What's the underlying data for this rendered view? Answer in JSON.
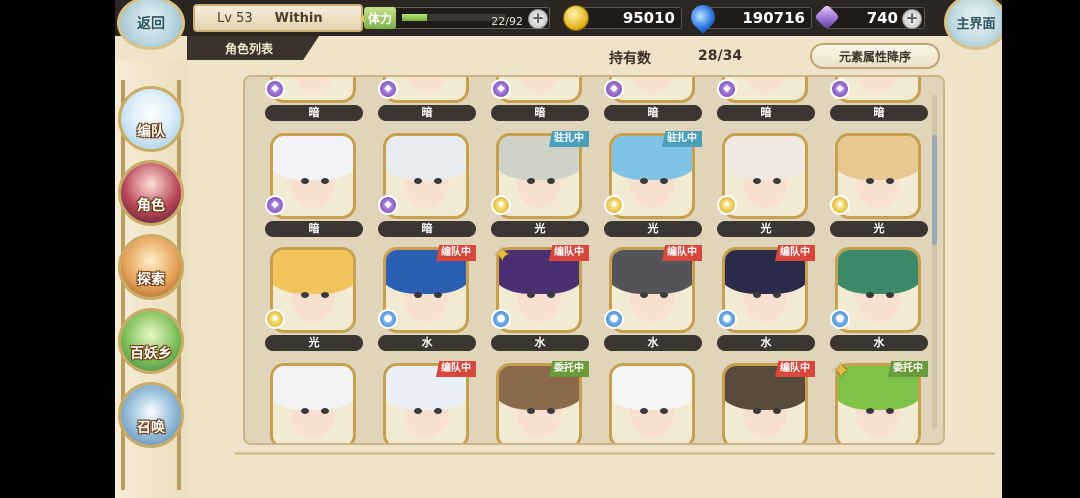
{
  "back_label": "返回",
  "home_label": "主界面",
  "player": {
    "level": "Lv 53",
    "name": "Within"
  },
  "stamina": {
    "label": "体力",
    "current": 22,
    "max": 92,
    "text": "22/92"
  },
  "currencies": {
    "gold": "95010",
    "crystal": "190716",
    "gem": "740"
  },
  "tab_title": "角色列表",
  "owned": {
    "label": "持有数",
    "count": "28/34"
  },
  "sort_label": "元素属性降序",
  "nav": [
    {
      "label": "编队"
    },
    {
      "label": "角色"
    },
    {
      "label": "探索"
    },
    {
      "label": "百妖乡"
    },
    {
      "label": "召唤"
    }
  ],
  "elements": {
    "dark": "暗",
    "light": "光",
    "water": "水"
  },
  "rows": [
    [
      {
        "element": "暗",
        "tag": ""
      },
      {
        "element": "暗",
        "tag": ""
      },
      {
        "element": "暗",
        "tag": ""
      },
      {
        "element": "暗",
        "tag": ""
      },
      {
        "element": "暗",
        "tag": ""
      },
      {
        "element": "暗",
        "tag": ""
      }
    ],
    [
      {
        "element": "暗",
        "tag": ""
      },
      {
        "element": "暗",
        "tag": ""
      },
      {
        "element": "光",
        "tag": "驻扎中"
      },
      {
        "element": "光",
        "tag": "驻扎中"
      },
      {
        "element": "光",
        "tag": ""
      },
      {
        "element": "光",
        "tag": ""
      }
    ],
    [
      {
        "element": "光",
        "tag": ""
      },
      {
        "element": "水",
        "tag": "编队中"
      },
      {
        "element": "水",
        "tag": "编队中"
      },
      {
        "element": "水",
        "tag": "编队中"
      },
      {
        "element": "水",
        "tag": "编队中"
      },
      {
        "element": "水",
        "tag": ""
      }
    ],
    [
      {
        "element": "",
        "tag": ""
      },
      {
        "element": "",
        "tag": "编队中"
      },
      {
        "element": "",
        "tag": "委托中"
      },
      {
        "element": "",
        "tag": ""
      },
      {
        "element": "",
        "tag": "编队中"
      },
      {
        "element": "",
        "tag": "委托中"
      }
    ]
  ],
  "colors": {
    "frame_gold": "#c9ab64",
    "panel_bg": "#e0d5ba",
    "team_tag": "#d8473c",
    "station_tag": "#4aa0b8",
    "delegate_tag": "#6a9a3a"
  }
}
